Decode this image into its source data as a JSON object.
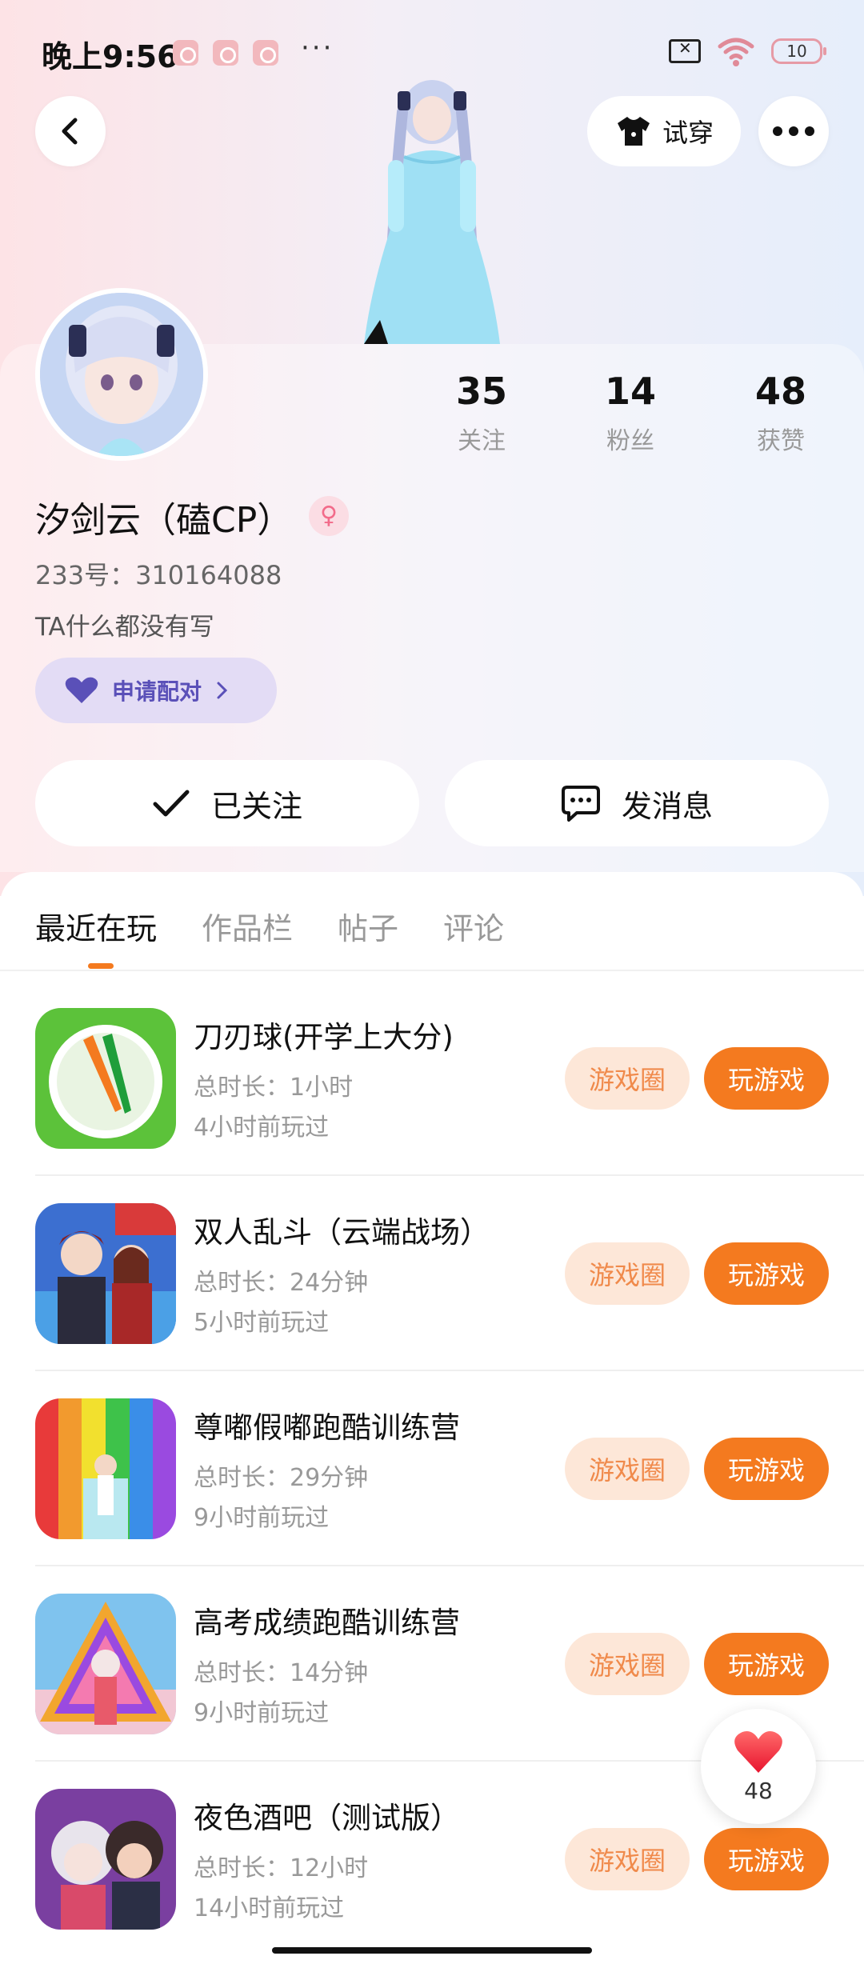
{
  "status_bar": {
    "time": "晚上9:56",
    "more": "···",
    "battery": "10"
  },
  "header": {
    "try_on_label": "试穿"
  },
  "profile": {
    "stats": [
      {
        "num": "35",
        "label": "关注"
      },
      {
        "num": "14",
        "label": "粉丝"
      },
      {
        "num": "48",
        "label": "获赞"
      }
    ],
    "nickname": "汐剑云（磕CP）",
    "gender_symbol": "♀",
    "user_id": "233号：310164088",
    "bio": "TA什么都没有写",
    "pair_label": "申请配对",
    "follow_label": "已关注",
    "message_label": "发消息"
  },
  "tabs": [
    {
      "label": "最近在玩",
      "active": true
    },
    {
      "label": "作品栏",
      "active": false
    },
    {
      "label": "帖子",
      "active": false
    },
    {
      "label": "评论",
      "active": false
    }
  ],
  "buttons": {
    "circle_label": "游戏圈",
    "play_label": "玩游戏"
  },
  "games": [
    {
      "title": "刀刃球(开学上大分)",
      "duration": "总时长：1小时",
      "last_played": "4小时前玩过"
    },
    {
      "title": "双人乱斗（云端战场）",
      "duration": "总时长：24分钟",
      "last_played": "5小时前玩过"
    },
    {
      "title": "尊嘟假嘟跑酷训练营",
      "duration": "总时长：29分钟",
      "last_played": "9小时前玩过"
    },
    {
      "title": "高考成绩跑酷训练营",
      "duration": "总时长：14分钟",
      "last_played": "9小时前玩过"
    },
    {
      "title": "夜色酒吧（测试版）",
      "duration": "总时长：12小时",
      "last_played": "14小时前玩过"
    }
  ],
  "like_float": {
    "count": "48"
  }
}
